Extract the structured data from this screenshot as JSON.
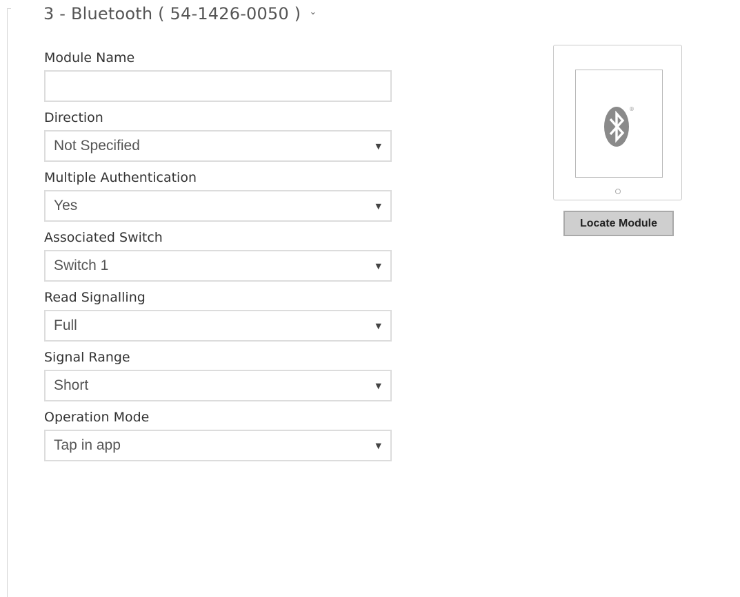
{
  "section": {
    "title": "3 - Bluetooth ( 54-1426-0050 )",
    "chevron_icon": "chevron-down-icon",
    "chevron_glyph": "⌄"
  },
  "form": {
    "module_name": {
      "label": "Module Name",
      "value": "",
      "placeholder": ""
    },
    "direction": {
      "label": "Direction",
      "selected": "Not Specified"
    },
    "multiple_authentication": {
      "label": "Multiple Authentication",
      "selected": "Yes"
    },
    "associated_switch": {
      "label": "Associated Switch",
      "selected": "Switch 1"
    },
    "read_signalling": {
      "label": "Read Signalling",
      "selected": "Full"
    },
    "signal_range": {
      "label": "Signal Range",
      "selected": "Short"
    },
    "operation_mode": {
      "label": "Operation Mode",
      "selected": "Tap in app"
    },
    "dropdown_arrow_glyph": "▼"
  },
  "module_preview": {
    "icon": "bluetooth-icon",
    "registered_mark": "®",
    "logo_color": "#8a8a8a",
    "locate_button_label": "Locate Module"
  }
}
